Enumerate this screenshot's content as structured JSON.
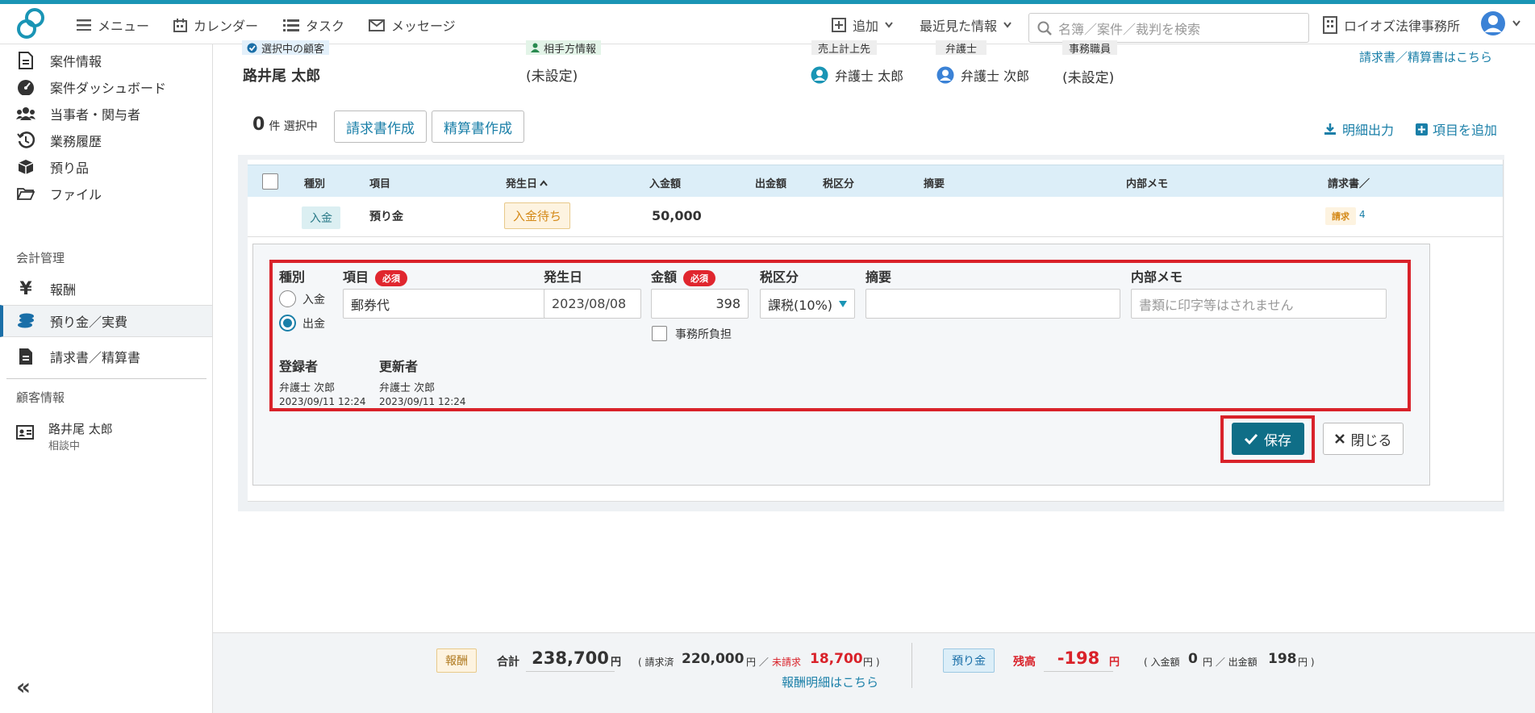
{
  "header": {
    "menu": "メニュー",
    "calendar": "カレンダー",
    "task": "タスク",
    "message": "メッセージ",
    "add": "追加",
    "recent": "最近見た情報",
    "search_placeholder": "名簿／案件／裁判を検索",
    "firm": "ロイオズ法律事務所"
  },
  "sidebar": {
    "items": [
      {
        "label": "案件情報"
      },
      {
        "label": "案件ダッシュボード"
      },
      {
        "label": "当事者・関与者"
      },
      {
        "label": "業務履歴"
      },
      {
        "label": "預り品"
      },
      {
        "label": "ファイル"
      }
    ],
    "accounting_header": "会計管理",
    "accounting": [
      {
        "label": "報酬"
      },
      {
        "label": "預り金／実費"
      },
      {
        "label": "請求書／精算書"
      }
    ],
    "client_header": "顧客情報",
    "client_name": "路井尾 太郎",
    "client_status": "相談中",
    "collapse": "«"
  },
  "info": {
    "selected_client_label": "選択中の顧客",
    "client_name": "路井尾 太郎",
    "opponent_label": "相手方情報",
    "opponent_value": "(未設定)",
    "sales_label": "売上計上先",
    "sales_value": "弁護士 太郎",
    "lawyer_label": "弁護士",
    "lawyer_value": "弁護士 次郎",
    "staff_label": "事務職員",
    "staff_value": "(未設定)",
    "invoice_link": "請求書／精算書はこちら"
  },
  "toolbar": {
    "count": "0",
    "count_suffix": "件 選択中",
    "invoice_btn": "請求書作成",
    "settlement_btn": "精算書作成",
    "export": "明細出力",
    "add_item": "項目を追加"
  },
  "table": {
    "headers": [
      "種別",
      "項目",
      "発生日",
      "入金額",
      "出金額",
      "税区分",
      "摘要",
      "内部メモ",
      "請求書／"
    ],
    "sort_arrow": "^",
    "row": {
      "type": "入金",
      "item": "預り金",
      "status": "入金待ち",
      "amount": "50,000",
      "invoice_chip": "請求",
      "invoice_no": "4"
    }
  },
  "editor": {
    "type_label": "種別",
    "radio_in": "入金",
    "radio_out": "出金",
    "item_label": "項目",
    "required": "必須",
    "item_value": "郵券代",
    "date_label": "発生日",
    "date_value": "2023/08/08",
    "amount_label": "金額",
    "amount_value": "398",
    "office_burden": "事務所負担",
    "tax_label": "税区分",
    "tax_value": "課税(10%)",
    "summary_label": "摘要",
    "summary_value": "",
    "memo_label": "内部メモ",
    "memo_placeholder": "書類に印字等はされません",
    "registrant_label": "登録者",
    "registrant_name": "弁護士 次郎",
    "registrant_time": "2023/09/11 12:24",
    "updater_label": "更新者",
    "updater_name": "弁護士 次郎",
    "updater_time": "2023/09/11 12:24",
    "save": "保存",
    "close": "閉じる"
  },
  "footer": {
    "fee_badge": "報酬",
    "total_label": "合計",
    "total_value": "238,700",
    "yen": "円",
    "billed_label": "( 請求済",
    "billed_value": "220,000",
    "slash_yen": "円 ／",
    "unbilled_label": "未請求",
    "unbilled_value": "18,700",
    "unbilled_suffix": "円 )",
    "fee_link": "報酬明細はこちら",
    "deposit_badge": "預り金",
    "balance_label": "残高",
    "balance_value": "-198",
    "in_label": "( 入金額",
    "in_value": "0",
    "out_label": "円 ／ 出金額",
    "out_value": "198",
    "close_paren": "円 )"
  },
  "colors": {
    "accent": "#1a95b5",
    "primary_button": "#0f6e87",
    "highlight_red": "#d9222a",
    "table_header": "#dceef8"
  }
}
